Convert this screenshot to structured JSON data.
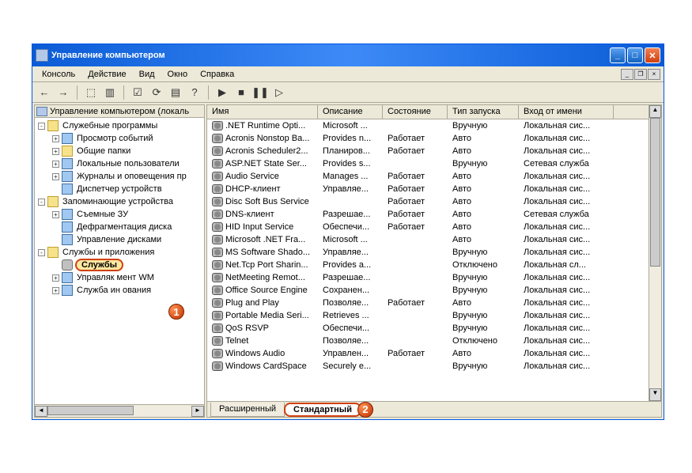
{
  "window": {
    "title": "Управление компьютером"
  },
  "menu": {
    "console": "Консоль",
    "action": "Действие",
    "view": "Вид",
    "window": "Окно",
    "help": "Справка"
  },
  "tree_head": "Управление компьютером (локаль",
  "tree": [
    {
      "indent": 0,
      "exp": "-",
      "icon": "folder",
      "label": "Служебные программы"
    },
    {
      "indent": 1,
      "exp": "+",
      "icon": "app",
      "label": "Просмотр событий"
    },
    {
      "indent": 1,
      "exp": "+",
      "icon": "folder",
      "label": "Общие папки"
    },
    {
      "indent": 1,
      "exp": "+",
      "icon": "app",
      "label": "Локальные пользователи"
    },
    {
      "indent": 1,
      "exp": "+",
      "icon": "app",
      "label": "Журналы и оповещения пр"
    },
    {
      "indent": 1,
      "exp": "",
      "icon": "app",
      "label": "Диспетчер устройств"
    },
    {
      "indent": 0,
      "exp": "-",
      "icon": "folder",
      "label": "Запоминающие устройства"
    },
    {
      "indent": 1,
      "exp": "+",
      "icon": "app",
      "label": "Съемные ЗУ"
    },
    {
      "indent": 1,
      "exp": "",
      "icon": "app",
      "label": "Дефрагментация диска"
    },
    {
      "indent": 1,
      "exp": "",
      "icon": "app",
      "label": "Управление дисками"
    },
    {
      "indent": 0,
      "exp": "-",
      "icon": "folder",
      "label": "Службы и приложения"
    },
    {
      "indent": 1,
      "exp": "",
      "icon": "gear",
      "label": "Службы",
      "selected": true
    },
    {
      "indent": 1,
      "exp": "+",
      "icon": "app",
      "label": "Управляк           мент WM"
    },
    {
      "indent": 1,
      "exp": "+",
      "icon": "app",
      "label": "Служба ин           ования"
    }
  ],
  "columns": {
    "name": "Имя",
    "desc": "Описание",
    "state": "Состояние",
    "startup": "Тип запуска",
    "logon": "Вход от имени"
  },
  "services": [
    {
      "name": ".NET Runtime Opti...",
      "desc": "Microsoft ...",
      "state": "",
      "startup": "Вручную",
      "logon": "Локальная сис..."
    },
    {
      "name": "Acronis Nonstop Ba...",
      "desc": "Provides n...",
      "state": "Работает",
      "startup": "Авто",
      "logon": "Локальная сис..."
    },
    {
      "name": "Acronis Scheduler2...",
      "desc": "Планиров...",
      "state": "Работает",
      "startup": "Авто",
      "logon": "Локальная сис..."
    },
    {
      "name": "ASP.NET State Ser...",
      "desc": "Provides s...",
      "state": "",
      "startup": "Вручную",
      "logon": "Сетевая служба"
    },
    {
      "name": "Audio Service",
      "desc": "Manages ...",
      "state": "Работает",
      "startup": "Авто",
      "logon": "Локальная сис..."
    },
    {
      "name": "DHCP-клиент",
      "desc": "Управляе...",
      "state": "Работает",
      "startup": "Авто",
      "logon": "Локальная сис..."
    },
    {
      "name": "Disc Soft Bus Service",
      "desc": "",
      "state": "Работает",
      "startup": "Авто",
      "logon": "Локальная сис..."
    },
    {
      "name": "DNS-клиент",
      "desc": "Разрешае...",
      "state": "Работает",
      "startup": "Авто",
      "logon": "Сетевая служба"
    },
    {
      "name": "HID Input Service",
      "desc": "Обеспечи...",
      "state": "Работает",
      "startup": "Авто",
      "logon": "Локальная сис..."
    },
    {
      "name": "Microsoft .NET Fra...",
      "desc": "Microsoft ...",
      "state": "",
      "startup": "Авто",
      "logon": "Локальная сис..."
    },
    {
      "name": "MS Software Shado...",
      "desc": "Управляе...",
      "state": "",
      "startup": "Вручную",
      "logon": "Локальная сис..."
    },
    {
      "name": "Net.Tcp Port Sharin...",
      "desc": "Provides a...",
      "state": "",
      "startup": "Отключено",
      "logon": "Локальная сл..."
    },
    {
      "name": "NetMeeting Remot...",
      "desc": "Разрешае...",
      "state": "",
      "startup": "Вручную",
      "logon": "Локальная сис..."
    },
    {
      "name": "Office Source Engine",
      "desc": "Сохранен...",
      "state": "",
      "startup": "Вручную",
      "logon": "Локальная сис..."
    },
    {
      "name": "Plug and Play",
      "desc": "Позволяе...",
      "state": "Работает",
      "startup": "Авто",
      "logon": "Локальная сис..."
    },
    {
      "name": "Portable Media Seri...",
      "desc": "Retrieves ...",
      "state": "",
      "startup": "Вручную",
      "logon": "Локальная сис..."
    },
    {
      "name": "QoS RSVP",
      "desc": "Обеспечи...",
      "state": "",
      "startup": "Вручную",
      "logon": "Локальная сис..."
    },
    {
      "name": "Telnet",
      "desc": "Позволяе...",
      "state": "",
      "startup": "Отключено",
      "logon": "Локальная сис..."
    },
    {
      "name": "Windows Audio",
      "desc": "Управлен...",
      "state": "Работает",
      "startup": "Авто",
      "logon": "Локальная сис..."
    },
    {
      "name": "Windows CardSpace",
      "desc": "Securely e...",
      "state": "",
      "startup": "Вручную",
      "logon": "Локальная сис..."
    }
  ],
  "tabs": {
    "extended": "Расширенный",
    "standard": "Стандартный"
  },
  "markers": {
    "one": "1",
    "two": "2"
  }
}
